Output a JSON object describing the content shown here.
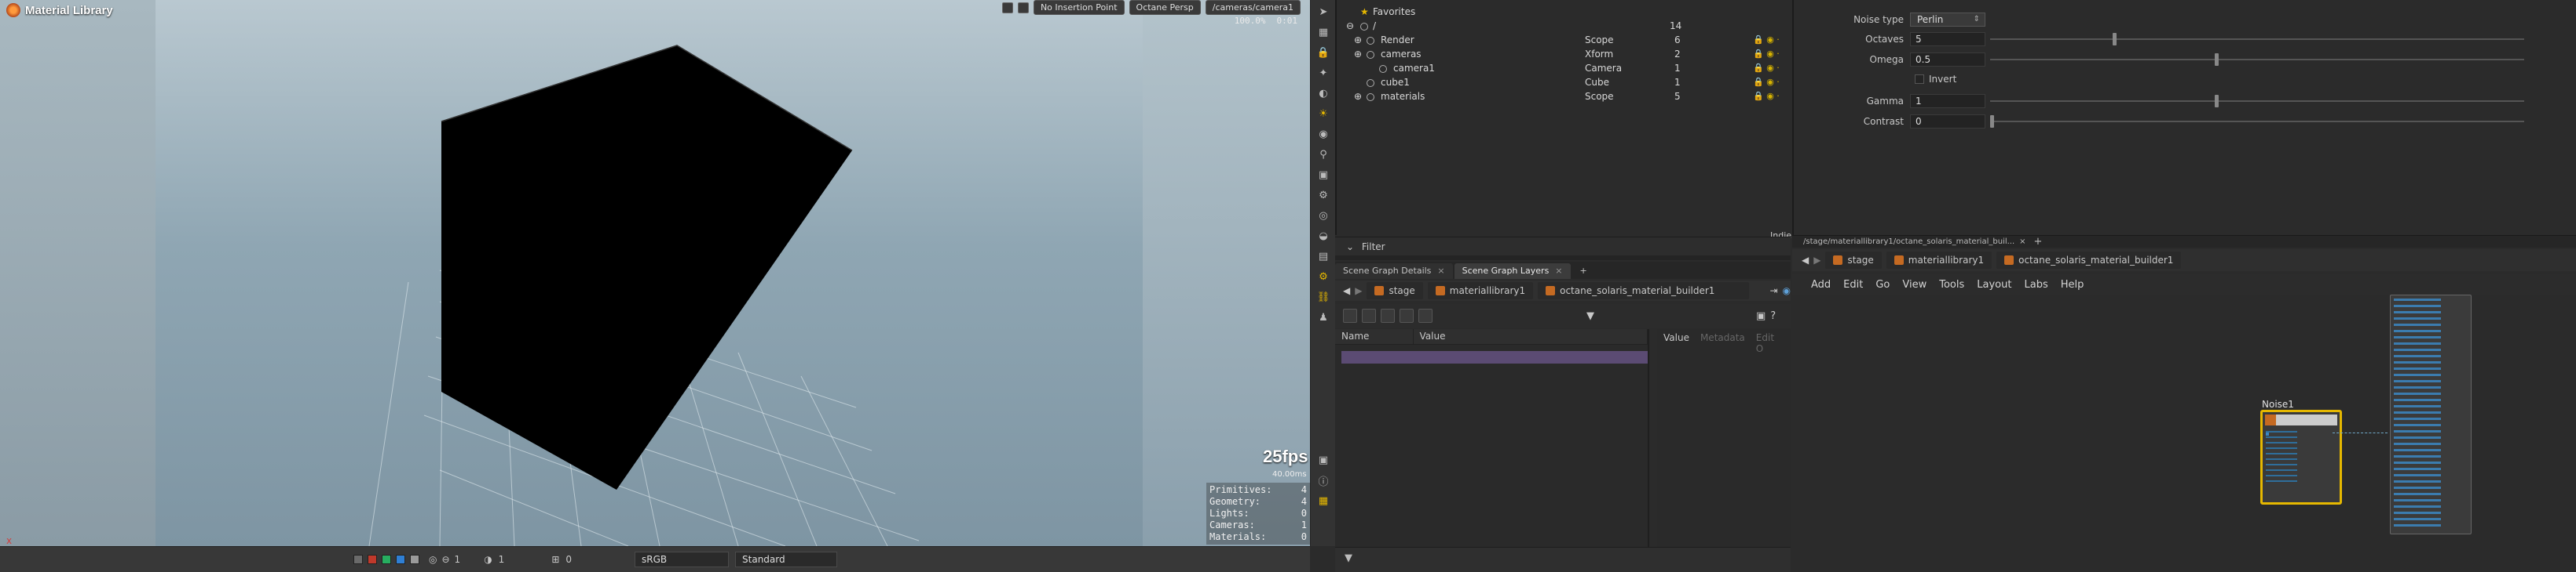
{
  "viewport": {
    "title": "Material Library",
    "insertion": "No Insertion Point",
    "camera": "Octane Persp",
    "camera_path": "/cameras/camera1",
    "zoom": "100.0%",
    "time": "0:01",
    "fps": "25fps",
    "frame_ms": "40.00ms",
    "stats": [
      {
        "label": "Primitives:",
        "value": "4"
      },
      {
        "label": "Geometry:",
        "value": "4"
      },
      {
        "label": "Lights:",
        "value": "0"
      },
      {
        "label": "Cameras:",
        "value": "1"
      },
      {
        "label": "Materials:",
        "value": "0"
      }
    ],
    "bottom": {
      "frame_a": "1",
      "frame_b": "0",
      "colorspace": "sRGB",
      "view_transform": "Standard",
      "swatches": [
        "#c0392b",
        "#27ae60",
        "#2f7fd4",
        "#9a9a9a"
      ]
    }
  },
  "scene_tree": {
    "favorites": "Favorites",
    "root": "/",
    "root_count": "14",
    "rows": [
      {
        "name": "Render",
        "type": "Scope",
        "count": "6"
      },
      {
        "name": "cameras",
        "type": "Xform",
        "count": "2"
      },
      {
        "name": "camera1",
        "type": "Camera",
        "count": "1"
      },
      {
        "name": "cube1",
        "type": "Cube",
        "count": "1"
      },
      {
        "name": "materials",
        "type": "Scope",
        "count": "5"
      }
    ],
    "license": "Indie",
    "filter_label": "Filter"
  },
  "scene_details": {
    "tabs": [
      {
        "label": "Scene Graph Details"
      },
      {
        "label": "Scene Graph Layers"
      }
    ],
    "path": [
      "stage",
      "materiallibrary1",
      "octane_solaris_material_builder1"
    ],
    "columns": {
      "name": "Name",
      "value": "Value"
    },
    "value_panel": {
      "value": "Value",
      "metadata": "Metadata",
      "edit": "Edit O"
    }
  },
  "parameters": {
    "noise_type_label": "Noise type",
    "noise_type_value": "Perlin",
    "octaves_label": "Octaves",
    "octaves_value": "5",
    "omega_label": "Omega",
    "omega_value": "0.5",
    "invert_label": "Invert",
    "gamma_label": "Gamma",
    "gamma_value": "1",
    "contrast_label": "Contrast",
    "contrast_value": "0",
    "octaves_fraction": 0.23,
    "omega_fraction": 0.42,
    "gamma_fraction": 0.42,
    "contrast_fraction": 0.0
  },
  "network": {
    "tab_path": "/stage/materiallibrary1/octane_solaris_material_buil...",
    "path": [
      "stage",
      "materiallibrary1",
      "octane_solaris_material_builder1"
    ],
    "menu": [
      "Add",
      "Edit",
      "Go",
      "View",
      "Tools",
      "Layout",
      "Labs",
      "Help"
    ],
    "noise_node": "Noise1"
  }
}
